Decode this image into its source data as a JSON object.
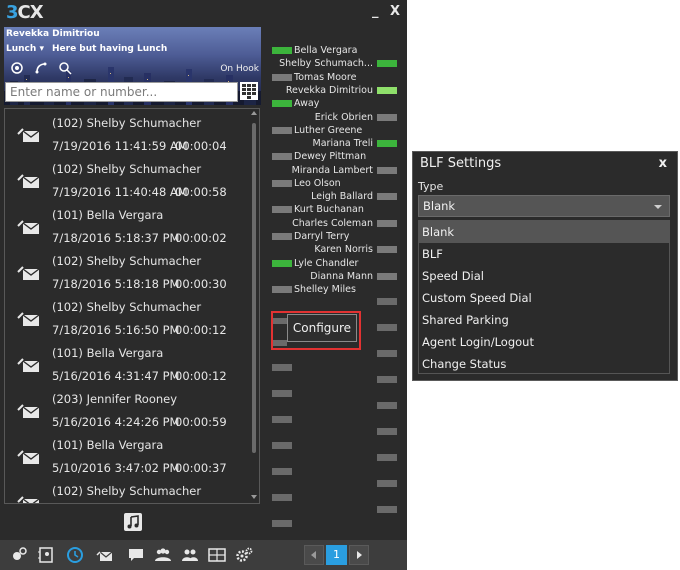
{
  "app": {
    "logo_num": "3",
    "logo_cx": "CX",
    "minimize_label": "_",
    "close_label": "X"
  },
  "profile": {
    "name": "Revekka Dimitriou",
    "status": "Lunch",
    "status_note": "Here but having Lunch",
    "hook_state": "On Hook",
    "search_placeholder": "Enter name or number..."
  },
  "calls": [
    {
      "name": "(102) Shelby Schumacher",
      "date": "7/19/2016 11:41:59 AM",
      "duration": "00:00:04"
    },
    {
      "name": "(102) Shelby Schumacher",
      "date": "7/19/2016 11:40:48 AM",
      "duration": "00:00:58"
    },
    {
      "name": "(101) Bella Vergara",
      "date": "7/18/2016 5:18:37 PM",
      "duration": "00:00:02"
    },
    {
      "name": "(102) Shelby Schumacher",
      "date": "7/18/2016 5:18:18 PM",
      "duration": "00:00:30"
    },
    {
      "name": "(102) Shelby Schumacher",
      "date": "7/18/2016 5:16:50 PM",
      "duration": "00:00:12"
    },
    {
      "name": "(101) Bella Vergara",
      "date": "5/16/2016 4:31:47 PM",
      "duration": "00:00:12"
    },
    {
      "name": "(203) Jennifer Rooney",
      "date": "5/16/2016 4:24:26 PM",
      "duration": "00:00:59"
    },
    {
      "name": "(101) Bella Vergara",
      "date": "5/10/2016 3:47:02 PM",
      "duration": "00:00:37"
    },
    {
      "name": "(102) Shelby Schumacher",
      "date": "",
      "duration": ""
    }
  ],
  "blf_left": [
    "Bella Vergara",
    "Tomas Moore",
    "Away",
    "Luther Greene",
    "Dewey Pittman",
    "Leo Olson",
    "Kurt Buchanan",
    "Darryl Terry",
    "Lyle Chandler",
    "Shelley Miles"
  ],
  "blf_right": [
    "Shelby Schumach...",
    "Revekka Dimitriou",
    "Erick Obrien",
    "Mariana Treli",
    "Miranda Lambert",
    "Leigh Ballard",
    "Charles Coleman",
    "Karen Norris",
    "Dianna Mann"
  ],
  "configure_label": "Configure",
  "pager": {
    "current_page": "1"
  },
  "colors": {
    "accent": "#2a9ee0",
    "blf_available": "#3cb43c",
    "blf_idle": "#7a7a7a",
    "highlight": "#e23232"
  },
  "dialog": {
    "title": "BLF Settings",
    "close_label": "x",
    "type_label": "Type",
    "selected_type": "Blank",
    "options": [
      "Blank",
      "BLF",
      "Speed Dial",
      "Custom Speed Dial",
      "Shared Parking",
      "Agent Login/Logout",
      "Change Status"
    ]
  },
  "icons": [
    "settings-icon",
    "contacts-icon",
    "call-history-icon",
    "voicemail-icon",
    "chat-icon",
    "people-icon",
    "conference-icon",
    "switchboard-icon",
    "gear-icon",
    "music-note-icon",
    "keypad-icon",
    "voicemail-envelope-icon"
  ]
}
